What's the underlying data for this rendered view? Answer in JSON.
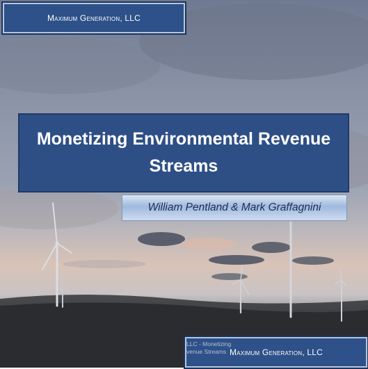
{
  "slide": {
    "header_badge": "Maximum Generation, LLC",
    "title": "Monetizing Environmental Revenue Streams",
    "subtitle": "William Pentland & Mark Graffagnini",
    "footer_text_line1": "LLC - Monetizing",
    "footer_text_line2": "venue Streams",
    "footer_badge": "Maximum Generation, LLC"
  },
  "colors": {
    "badge_fill": "#2d5188",
    "title_fill": "#2e4f86",
    "subtitle_fill": "#b7cbe8",
    "sky_top": "#6d7890",
    "sky_horizon": "#d8c2b6",
    "ground": "#2a2c30"
  },
  "icons": [
    "wind-turbine"
  ]
}
